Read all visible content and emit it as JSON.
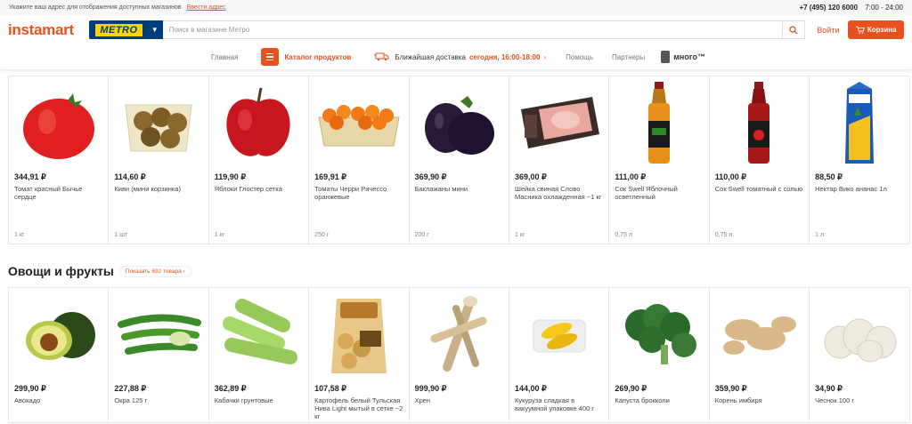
{
  "topbar": {
    "notice": "Укажите ваш адрес для отображения доступных магазинов",
    "address_link": "Ввести адрес",
    "phone": "+7 (495) 120 6000",
    "hours": "7:00 - 24:00"
  },
  "header": {
    "logo": "instamart",
    "store": "METRO",
    "search_placeholder": "Поиск в магазине Метро",
    "login": "Войти",
    "cart": "Корзина"
  },
  "nav": {
    "home": "Главная",
    "catalog": "Каталог продуктов",
    "delivery_label": "Ближайшая доставка",
    "delivery_time": "сегодня, 16:00-18:00",
    "help": "Помощь",
    "partners": "Партнеры",
    "mnogo": "много™"
  },
  "products_top": [
    {
      "price": "344,91 ₽",
      "name": "Томат красный Бычье сердце",
      "weight": "1 кг"
    },
    {
      "price": "114,60 ₽",
      "name": "Киви (мини корзинка)",
      "weight": "1 шт"
    },
    {
      "price": "119,90 ₽",
      "name": "Яблоки Глостер сетка",
      "weight": "1 кг"
    },
    {
      "price": "169,91 ₽",
      "name": "Томаты Черри Ричессо оранжевые",
      "weight": "250 г"
    },
    {
      "price": "369,90 ₽",
      "name": "Баклажаны мини",
      "weight": "200 г"
    },
    {
      "price": "369,00 ₽",
      "name": "Шейка свиная Слово Масника охлажденная ~1 кг",
      "weight": "1 кг"
    },
    {
      "price": "111,00 ₽",
      "name": "Сок Swell Яблочный осветленный",
      "weight": "0,75 л"
    },
    {
      "price": "110,00 ₽",
      "name": "Сок Swell томатный с солью",
      "weight": "0,75 л"
    },
    {
      "price": "88,50 ₽",
      "name": "Нектар Вико ананас 1л",
      "weight": "1 л"
    }
  ],
  "section": {
    "title": "Овощи и фрукты",
    "more": "Показать 692 товара ›"
  },
  "products_bottom": [
    {
      "price": "299,90 ₽",
      "name": "Авокадо"
    },
    {
      "price": "227,88 ₽",
      "name": "Окра 125 г"
    },
    {
      "price": "362,89 ₽",
      "name": "Кабачки грунтовые"
    },
    {
      "price": "107,58 ₽",
      "name": "Картофель белый Тульская Нива Light мытый в сетке ~2 кг"
    },
    {
      "price": "999,90 ₽",
      "name": "Хрен"
    },
    {
      "price": "144,00 ₽",
      "name": "Кукуруза сладкая в вакуумной упаковке 400 г"
    },
    {
      "price": "269,90 ₽",
      "name": "Капуста брокколи"
    },
    {
      "price": "359,90 ₽",
      "name": "Корень имбиря"
    },
    {
      "price": "34,90 ₽",
      "name": "Чеснок 100 г"
    }
  ],
  "colors": {
    "accent": "#e8501d",
    "metro_blue": "#003d7d",
    "metro_yellow": "#ffd200"
  }
}
